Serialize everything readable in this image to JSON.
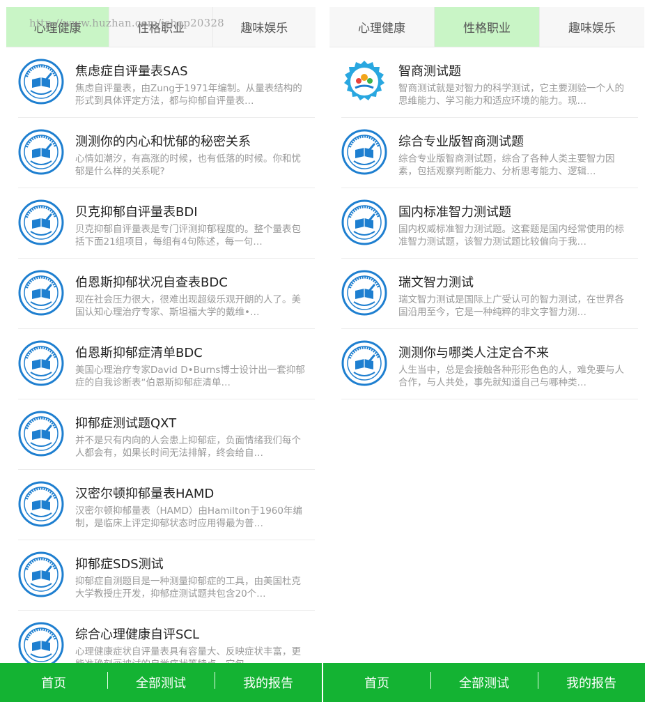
{
  "watermark": "http://www.huzhan.com/ishop20328",
  "colors": {
    "accent": "#14b333",
    "active_tab": "#c9f5c6",
    "logo_blue": "#1e7fd0"
  },
  "left": {
    "tabs": [
      {
        "label": "心理健康",
        "active": true
      },
      {
        "label": "性格职业",
        "active": false
      },
      {
        "label": "趣味娱乐",
        "active": false
      }
    ],
    "items": [
      {
        "title": "焦虑症自评量表SAS",
        "desc": "焦虑自评量表，由Zung于1971年编制。从量表结构的形式到具体评定方法，都与抑郁自评量表…",
        "icon": "test-logo-icon"
      },
      {
        "title": "测测你的内心和忧郁的秘密关系",
        "desc": "心情如潮汐，有高涨的时候，也有低落的时候。你和忧郁是什么样的关系呢?",
        "icon": "test-logo-icon"
      },
      {
        "title": "贝克抑郁自评量表BDI",
        "desc": "贝克抑郁自评量表是专门评测抑郁程度的。整个量表包括下面21组项目，每组有4句陈述，每一句…",
        "icon": "test-logo-icon"
      },
      {
        "title": "伯恩斯抑郁状况自查表BDC",
        "desc": "现在社会压力很大，很难出现超级乐观开朗的人了。美国认知心理治疗专家、斯坦福大学的戴维•…",
        "icon": "test-logo-icon"
      },
      {
        "title": "伯恩斯抑郁症清单BDC",
        "desc": "美国心理治疗专家David D•Burns博士设计出一套抑郁症的自我诊断表“伯恩斯抑郁症清单…",
        "icon": "test-logo-icon"
      },
      {
        "title": "抑郁症测试题QXT",
        "desc": "并不是只有内向的人会患上抑郁症，负面情绪我们每个人都会有，如果长时间无法排解，终会给自…",
        "icon": "test-logo-icon"
      },
      {
        "title": "汉密尔顿抑郁量表HAMD",
        "desc": "汉密尔顿抑郁量表（HAMD）由Hamilton于1960年编制，是临床上评定抑郁状态时应用得最为普…",
        "icon": "test-logo-icon"
      },
      {
        "title": "抑郁症SDS测试",
        "desc": "抑郁症自测题目是一种测量抑郁症的工具，由美国杜克大学教授庄开发，抑郁症测试题共包含20个…",
        "icon": "test-logo-icon"
      },
      {
        "title": "综合心理健康自评SCL",
        "desc": "心理健康症状自评量表具有容量大、反映症状丰富，更能准确刻画被试的自觉症状等特点，它包…",
        "icon": "test-logo-icon"
      }
    ],
    "nav": [
      "首页",
      "全部测试",
      "我的报告"
    ]
  },
  "right": {
    "tabs": [
      {
        "label": "心理健康",
        "active": false
      },
      {
        "label": "性格职业",
        "active": true
      },
      {
        "label": "趣味娱乐",
        "active": false
      }
    ],
    "items": [
      {
        "title": "智商测试题",
        "desc": "智商测试就是对智力的科学测试，它主要测验一个人的思维能力、学习能力和适应环境的能力。现…",
        "icon": "kids-logo-icon"
      },
      {
        "title": "综合专业版智商测试题",
        "desc": "综合专业版智商测试题，综合了各种人类主要智力因素，包括观察判断能力、分析思考能力、逻辑…",
        "icon": "test-logo-icon"
      },
      {
        "title": "国内标准智力测试题",
        "desc": "国内权威标准智力测试题。这套题是国内经常使用的标准智力测试题，该智力测试题比较偏向于我…",
        "icon": "test-logo-icon"
      },
      {
        "title": "瑞文智力测试",
        "desc": "瑞文智力测试是国际上广受认可的智力测试，在世界各国沿用至今，它是一种纯粹的非文字智力测…",
        "icon": "test-logo-icon"
      },
      {
        "title": "测测你与哪类人注定合不来",
        "desc": "人生当中，总是会接触各种形形色色的人，难免要与人合作，与人共处，事先就知道自己与哪种类…",
        "icon": "test-logo-icon"
      }
    ],
    "nav": [
      "首页",
      "全部测试",
      "我的报告"
    ]
  }
}
